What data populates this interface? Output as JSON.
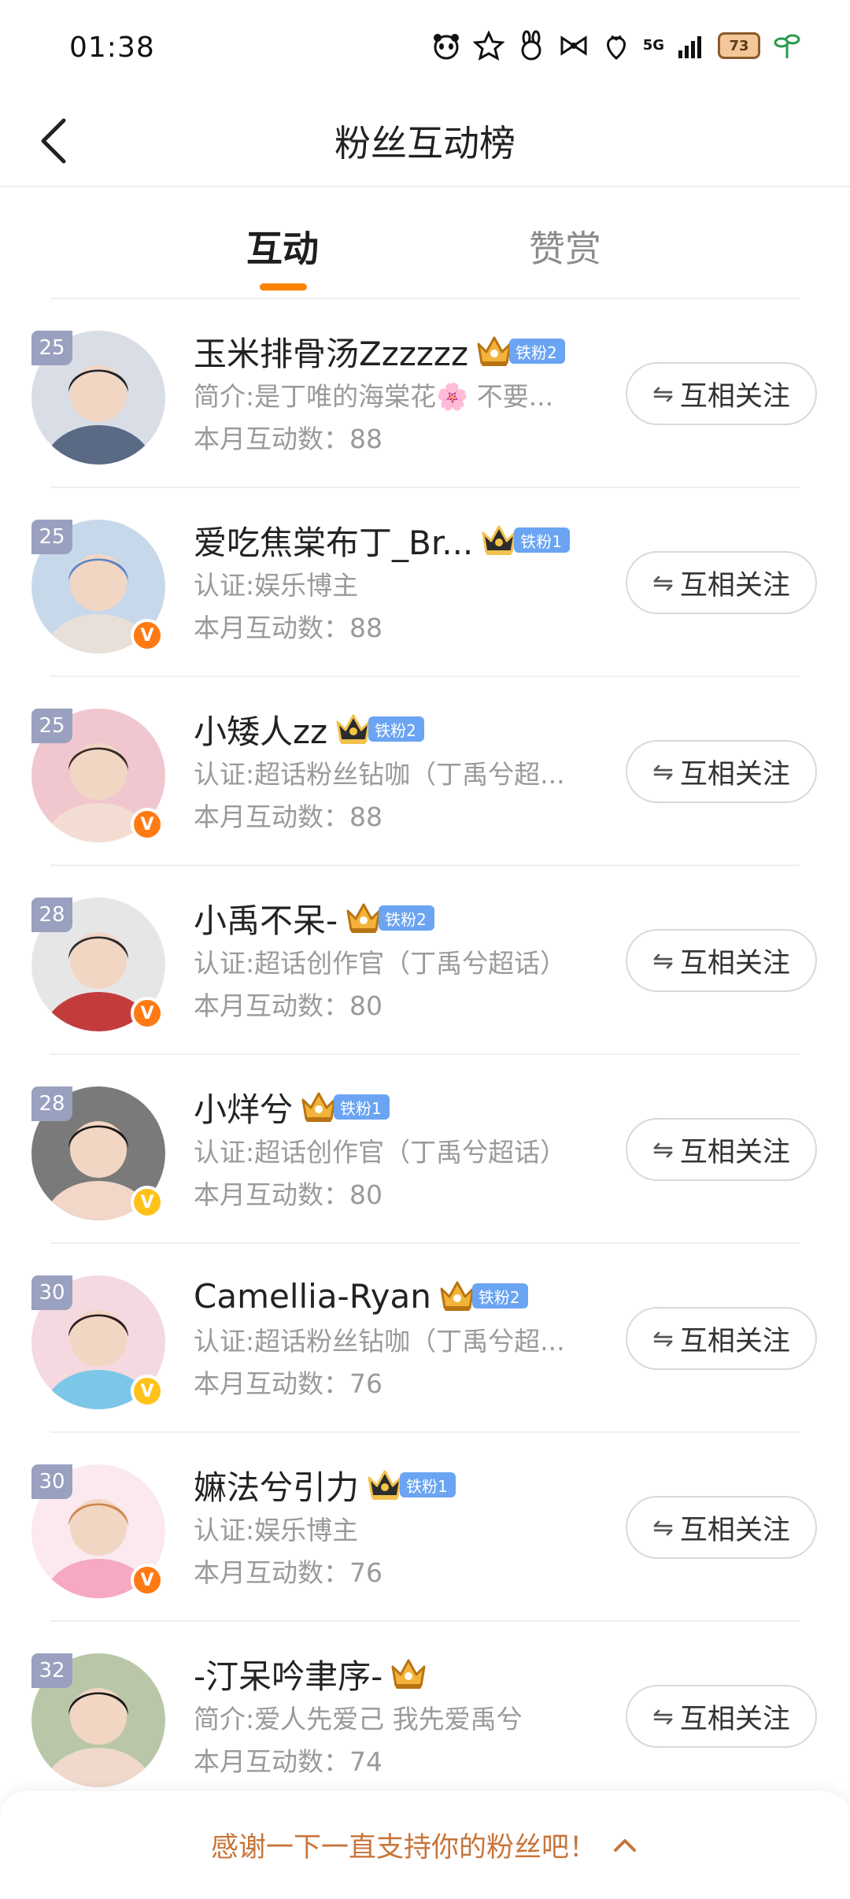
{
  "status_bar": {
    "time": "01:38",
    "network": "5G",
    "battery": "73",
    "icons": [
      "panda-icon",
      "star-face-icon",
      "bunny-icon",
      "bow-icon",
      "strawberry-icon",
      "signal-icon",
      "battery-icon",
      "charging-plant-icon"
    ]
  },
  "header": {
    "title": "粉丝互动榜",
    "back_icon": "chevron-left-icon"
  },
  "tabs": [
    {
      "label": "互动",
      "active": true
    },
    {
      "label": "赞赏",
      "active": false
    }
  ],
  "list": [
    {
      "rank": "25",
      "name": "玉米排骨汤Zzzzzz",
      "crown": "gold",
      "fan_level": "铁粉2",
      "subtitle": "简介:是丁唯的海棠花🌸 不要...",
      "count_label": "本月互动数：",
      "count": "88",
      "verified": "",
      "button": "互相关注",
      "avatar_colors": [
        "#d9dee6",
        "#20242c",
        "#5a6a85"
      ]
    },
    {
      "rank": "25",
      "name": "爱吃焦棠布丁_Br...",
      "crown": "dark",
      "fan_level": "铁粉1",
      "subtitle": "认证:娱乐博主",
      "count_label": "本月互动数：",
      "count": "88",
      "verified": "orange",
      "button": "互相关注",
      "avatar_colors": [
        "#c7d8ea",
        "#5c84c6",
        "#e8e0d8"
      ]
    },
    {
      "rank": "25",
      "name": "小矮人zz",
      "crown": "dark",
      "fan_level": "铁粉2",
      "subtitle": "认证:超话粉丝钻咖（丁禹兮超...",
      "count_label": "本月互动数：",
      "count": "88",
      "verified": "orange",
      "button": "互相关注",
      "avatar_colors": [
        "#f1c7cf",
        "#3a2a26",
        "#f3ddd2"
      ]
    },
    {
      "rank": "28",
      "name": "小禹不呆-",
      "crown": "gold",
      "fan_level": "铁粉2",
      "subtitle": "认证:超话创作官（丁禹兮超话）",
      "count_label": "本月互动数：",
      "count": "80",
      "verified": "orange",
      "button": "互相关注",
      "avatar_colors": [
        "#e6e6e6",
        "#2b2b2b",
        "#c33c3c"
      ]
    },
    {
      "rank": "28",
      "name": "小烊兮",
      "crown": "gold",
      "fan_level": "铁粉1",
      "subtitle": "认证:超话创作官（丁禹兮超话）",
      "count_label": "本月互动数：",
      "count": "80",
      "verified": "gold",
      "button": "互相关注",
      "avatar_colors": [
        "#7a7a7a",
        "#1f1a18",
        "#f2d6c8"
      ]
    },
    {
      "rank": "30",
      "name": "Camellia-Ryan",
      "crown": "gold",
      "fan_level": "铁粉2",
      "subtitle": "认证:超话粉丝钻咖（丁禹兮超...",
      "count_label": "本月互动数：",
      "count": "76",
      "verified": "gold",
      "button": "互相关注",
      "avatar_colors": [
        "#f4d9e0",
        "#2a201e",
        "#7cc7e8"
      ]
    },
    {
      "rank": "30",
      "name": "嫲法兮引力",
      "crown": "dark",
      "fan_level": "铁粉1",
      "subtitle": "认证:娱乐博主",
      "count_label": "本月互动数：",
      "count": "76",
      "verified": "orange",
      "button": "互相关注",
      "avatar_colors": [
        "#fbe9ef",
        "#d0844a",
        "#f6a9c1"
      ]
    },
    {
      "rank": "32",
      "name": "-汀呆吟聿序-",
      "crown": "gold",
      "fan_level": "",
      "subtitle": "简介:爱人先爱己 我先爱禹兮",
      "count_label": "本月互动数：",
      "count": "74",
      "verified": "",
      "button": "互相关注",
      "avatar_colors": [
        "#b9c7a8",
        "#1d1a1a",
        "#f0d9cc"
      ]
    }
  ],
  "bottom_bar": {
    "text": "感谢一下一直支持你的粉丝吧！",
    "icon": "chevron-up-icon"
  },
  "colors": {
    "accent": "#ff8200",
    "rank_badge": "#9aa0bf",
    "fan_tag": "#6aa4f2",
    "verify_orange": "#ff7a12",
    "verify_gold": "#ffc21a",
    "bottom_text": "#c8753a"
  }
}
